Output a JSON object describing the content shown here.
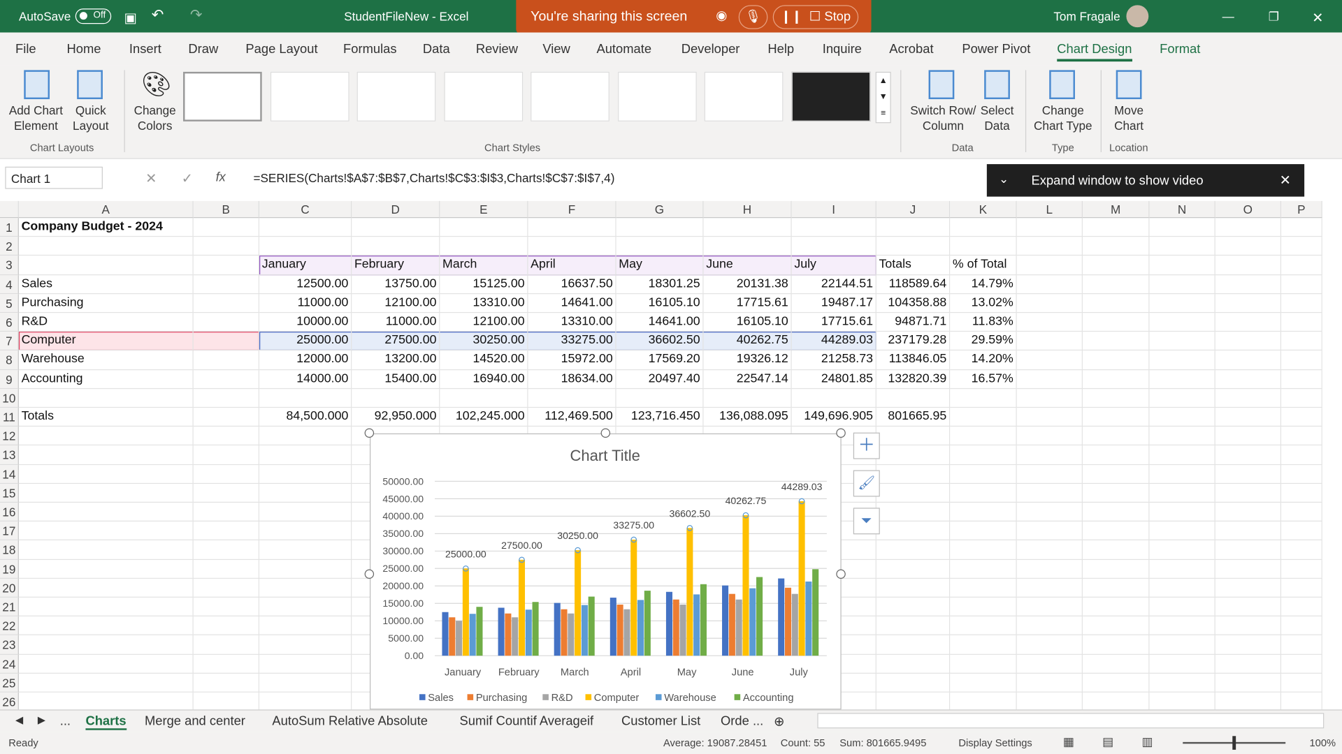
{
  "titlebar": {
    "autosave": "AutoSave",
    "autosave_state": "Off",
    "doc_title": "StudentFileNew  -  Excel",
    "user": "Tom Fragale"
  },
  "share": {
    "text": "You're sharing this screen",
    "stop": "Stop"
  },
  "menu": [
    "File",
    "Home",
    "Insert",
    "Draw",
    "Page Layout",
    "Formulas",
    "Data",
    "Review",
    "View",
    "Automate",
    "Developer",
    "Help",
    "Inquire",
    "Acrobat",
    "Power Pivot",
    "Chart Design",
    "Format"
  ],
  "ribbon": {
    "add_chart_element": "Add Chart Element",
    "quick_layout": "Quick Layout",
    "change_colors": "Change Colors",
    "switch_row_col": "Switch Row/ Column",
    "select_data": "Select Data",
    "change_chart_type": "Change Chart Type",
    "move_chart": "Move Chart",
    "groups": {
      "chart_layouts": "Chart Layouts",
      "chart_styles": "Chart Styles",
      "data": "Data",
      "type": "Type",
      "location": "Location"
    }
  },
  "formula_bar": {
    "name_box": "Chart 1",
    "fx": "fx",
    "formula": "=SERIES(Charts!$A$7:$B$7,Charts!$C$3:$I$3,Charts!$C$7:$I$7,4)"
  },
  "video_banner": {
    "text": "Expand window to show video"
  },
  "sheet": {
    "columns": [
      "A",
      "B",
      "C",
      "D",
      "E",
      "F",
      "G",
      "H",
      "I",
      "J",
      "K",
      "L",
      "M",
      "N",
      "O",
      "P"
    ],
    "rows": [
      {
        "A": "Company Budget - 2024"
      },
      {},
      {
        "C": "January",
        "D": "February",
        "E": "March",
        "F": "April",
        "G": "May",
        "H": "June",
        "I": "July",
        "J": "Totals",
        "K": "% of Total"
      },
      {
        "A": "Sales",
        "C": "12500.00",
        "D": "13750.00",
        "E": "15125.00",
        "F": "16637.50",
        "G": "18301.25",
        "H": "20131.38",
        "I": "22144.51",
        "J": "118589.64",
        "K": "14.79%"
      },
      {
        "A": "Purchasing",
        "C": "11000.00",
        "D": "12100.00",
        "E": "13310.00",
        "F": "14641.00",
        "G": "16105.10",
        "H": "17715.61",
        "I": "19487.17",
        "J": "104358.88",
        "K": "13.02%"
      },
      {
        "A": "R&D",
        "C": "10000.00",
        "D": "11000.00",
        "E": "12100.00",
        "F": "13310.00",
        "G": "14641.00",
        "H": "16105.10",
        "I": "17715.61",
        "J": "94871.71",
        "K": "11.83%"
      },
      {
        "A": "Computer",
        "C": "25000.00",
        "D": "27500.00",
        "E": "30250.00",
        "F": "33275.00",
        "G": "36602.50",
        "H": "40262.75",
        "I": "44289.03",
        "J": "237179.28",
        "K": "29.59%"
      },
      {
        "A": "Warehouse",
        "C": "12000.00",
        "D": "13200.00",
        "E": "14520.00",
        "F": "15972.00",
        "G": "17569.20",
        "H": "19326.12",
        "I": "21258.73",
        "J": "113846.05",
        "K": "14.20%"
      },
      {
        "A": "Accounting",
        "C": "14000.00",
        "D": "15400.00",
        "E": "16940.00",
        "F": "18634.00",
        "G": "20497.40",
        "H": "22547.14",
        "I": "24801.85",
        "J": "132820.39",
        "K": "16.57%"
      },
      {},
      {
        "A": "Totals",
        "C": "84,500.000",
        "D": "92,950.000",
        "E": "102,245.000",
        "F": "112,469.500",
        "G": "123,716.450",
        "H": "136,088.095",
        "I": "149,696.905",
        "J": "801665.95"
      },
      {},
      {},
      {},
      {},
      {},
      {},
      {},
      {},
      {},
      {},
      {},
      {},
      {},
      {},
      {}
    ]
  },
  "chart_data": {
    "type": "bar",
    "title": "Chart Title",
    "categories": [
      "January",
      "February",
      "March",
      "April",
      "May",
      "June",
      "July"
    ],
    "ylim": [
      0,
      50000
    ],
    "yticks": [
      "0.00",
      "5000.00",
      "10000.00",
      "15000.00",
      "20000.00",
      "25000.00",
      "30000.00",
      "35000.00",
      "40000.00",
      "45000.00",
      "50000.00"
    ],
    "legend_position": "bottom",
    "series": [
      {
        "name": "Sales",
        "color": "#4472c4",
        "values": [
          12500,
          13750,
          15125,
          16637.5,
          18301.25,
          20131.38,
          22144.51
        ]
      },
      {
        "name": "Purchasing",
        "color": "#ed7d31",
        "values": [
          11000,
          12100,
          13310,
          14641,
          16105.1,
          17715.61,
          19487.17
        ]
      },
      {
        "name": "R&D",
        "color": "#a5a5a5",
        "values": [
          10000,
          11000,
          12100,
          13310,
          14641,
          16105.1,
          17715.61
        ]
      },
      {
        "name": "Computer",
        "color": "#ffc000",
        "values": [
          25000,
          27500,
          30250,
          33275,
          36602.5,
          40262.75,
          44289.03
        ],
        "labels": [
          "25000.00",
          "27500.00",
          "30250.00",
          "33275.00",
          "36602.50",
          "40262.75",
          "44289.03"
        ]
      },
      {
        "name": "Warehouse",
        "color": "#5b9bd5",
        "values": [
          12000,
          13200,
          14520,
          15972,
          17569.2,
          19326.12,
          21258.73
        ]
      },
      {
        "name": "Accounting",
        "color": "#70ad47",
        "values": [
          14000,
          15400,
          16940,
          18634,
          20497.4,
          22547.14,
          24801.85
        ]
      }
    ]
  },
  "sheet_tabs": {
    "items": [
      "Charts",
      "Merge and center",
      "AutoSum Relative Absolute",
      "Sumif Countif Averageif",
      "Customer List",
      "Orde ..."
    ],
    "more": "..."
  },
  "status": {
    "ready": "Ready",
    "average": "Average: 19087.28451",
    "count": "Count: 55",
    "sum": "Sum: 801665.9495",
    "display_settings": "Display Settings",
    "zoom": "100%"
  }
}
